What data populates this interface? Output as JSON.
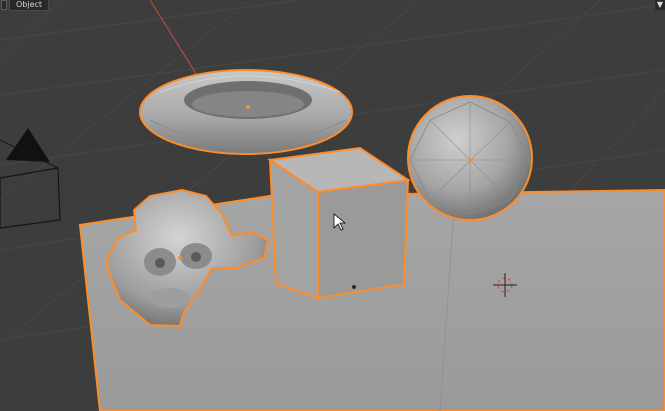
{
  "header": {
    "mode_label": "Object"
  },
  "colors": {
    "selection_outline": "#ff8c2a",
    "viewport_bg": "#3d3d3d",
    "object_gray": "#a9a9a9",
    "axis_x_red": "#b94444",
    "axis_y_green": "#6e9e3c"
  },
  "icons": {
    "mode": "object-mode-icon",
    "corner": "widget-icon",
    "cursor": "mouse-pointer-icon",
    "cursor3d": "3d-cursor-icon",
    "camera": "camera-icon"
  }
}
